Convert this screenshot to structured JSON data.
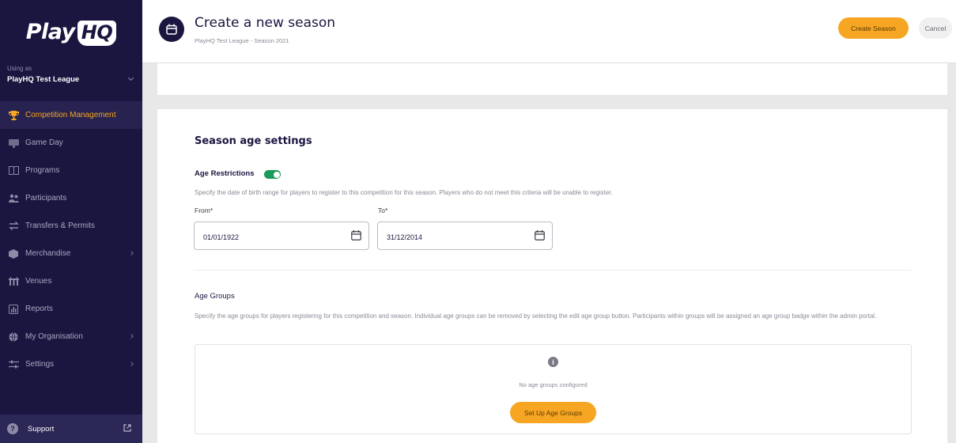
{
  "brand": {
    "name": "Play",
    "badge": "HQ"
  },
  "org": {
    "caption": "Using as",
    "name": "PlayHQ Test League"
  },
  "nav": [
    {
      "label": "Competition Management",
      "icon": "trophy-icon",
      "active": true,
      "arrow": false
    },
    {
      "label": "Game Day",
      "icon": "scoreboard-icon",
      "active": false,
      "arrow": false
    },
    {
      "label": "Programs",
      "icon": "book-icon",
      "active": false,
      "arrow": false
    },
    {
      "label": "Participants",
      "icon": "people-icon",
      "active": false,
      "arrow": false
    },
    {
      "label": "Transfers & Permits",
      "icon": "transfer-icon",
      "active": false,
      "arrow": false
    },
    {
      "label": "Merchandise",
      "icon": "merch-icon",
      "active": false,
      "arrow": true
    },
    {
      "label": "Venues",
      "icon": "stadium-icon",
      "active": false,
      "arrow": false
    },
    {
      "label": "Reports",
      "icon": "reports-icon",
      "active": false,
      "arrow": false
    },
    {
      "label": "My Organisation",
      "icon": "globe-icon",
      "active": false,
      "arrow": true
    },
    {
      "label": "Settings",
      "icon": "sliders-icon",
      "active": false,
      "arrow": true
    }
  ],
  "support": {
    "label": "Support"
  },
  "header": {
    "title": "Create a new season",
    "subtitle": "PlayHQ Test League - Season 2021",
    "create_label": "Create Season",
    "cancel_label": "Cancel"
  },
  "age_settings": {
    "title": "Season age settings",
    "restrictions_label": "Age Restrictions",
    "restrictions_enabled": true,
    "description": "Specify the date of birth range for players to register to this competition for this season. Players who do not meet this criteria will be unable to register.",
    "from_label": "From*",
    "from_value": "01/01/1922",
    "to_label": "To*",
    "to_value": "31/12/2014"
  },
  "age_groups": {
    "title": "Age Groups",
    "description": "Specify the age groups for players registering for this competition and season. Individual age groups can be removed by selecting the edit age group button. Participants within groups will be assigned an age group badge within the admin portal.",
    "empty_text": "No age groups configured",
    "setup_label": "Set Up Age Groups"
  },
  "colors": {
    "sidebar": "#1a1640",
    "accent": "#f6a623",
    "toggle": "#1a9a5a"
  }
}
